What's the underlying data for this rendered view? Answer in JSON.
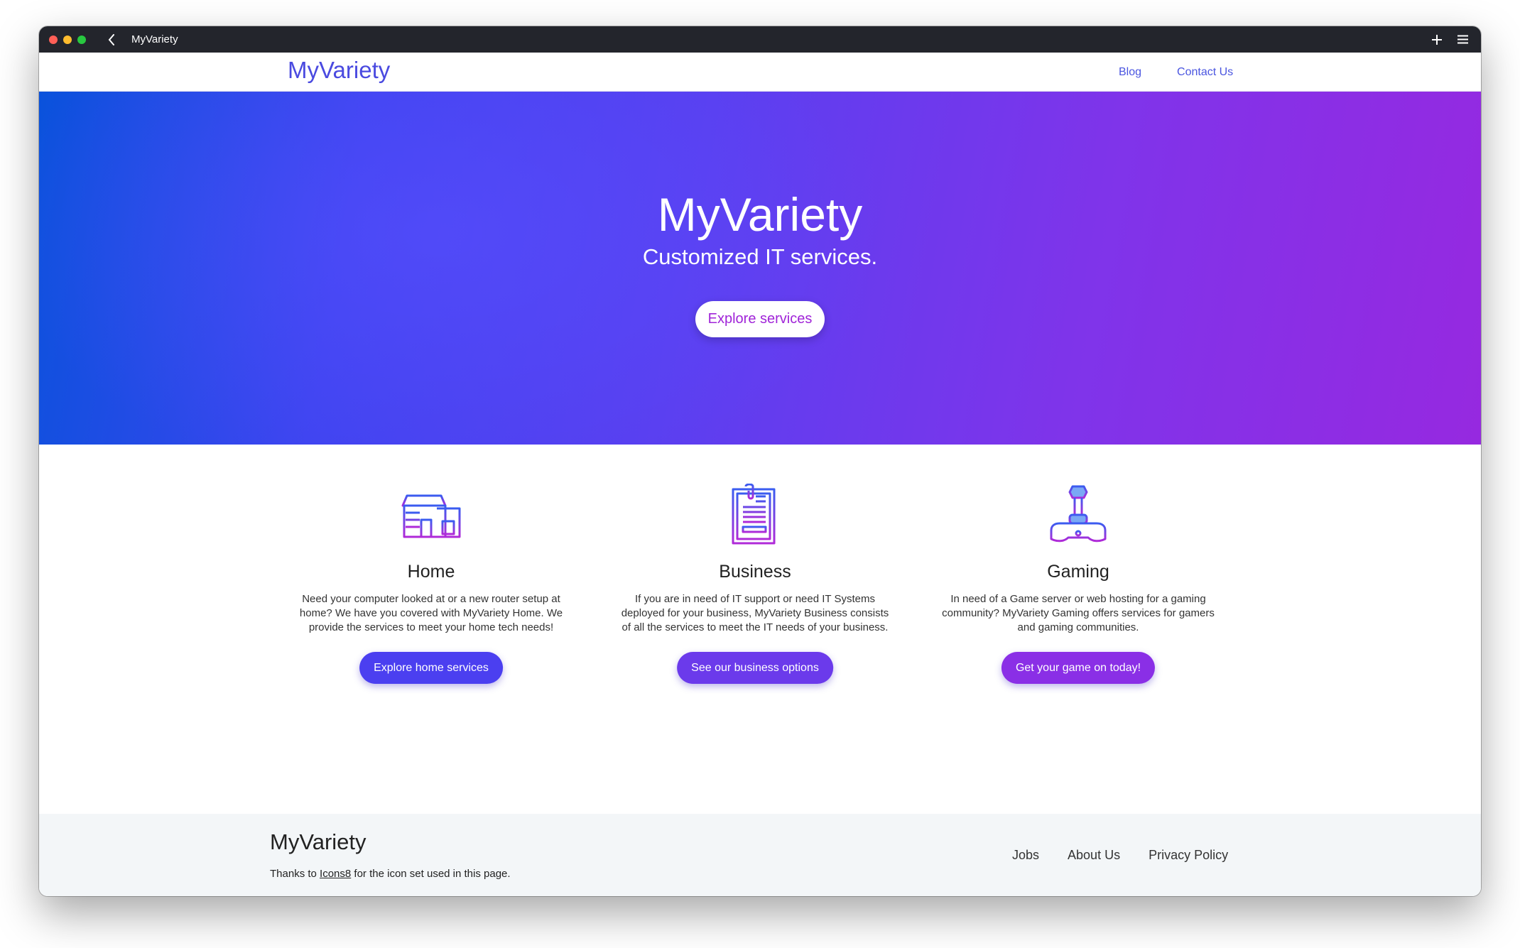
{
  "browser": {
    "tab_title": "MyVariety"
  },
  "nav": {
    "brand": "MyVariety",
    "links": [
      "Blog",
      "Contact Us"
    ]
  },
  "hero": {
    "title": "MyVariety",
    "subtitle": "Customized IT services.",
    "button": "Explore services"
  },
  "services": [
    {
      "icon": "house-icon",
      "title": "Home",
      "text": "Need your computer looked at or a new router setup at home? We have you covered with MyVariety Home. We provide the services to meet your home tech needs!",
      "button": "Explore home services",
      "button_color": "#4b3ff0"
    },
    {
      "icon": "clipboard-icon",
      "title": "Business",
      "text": "If you are in need of IT support or need IT Systems deployed for your business, MyVariety Business consists of all the services to meet the IT needs of your business.",
      "button": "See our business options",
      "button_color": "#6b3aeb"
    },
    {
      "icon": "joystick-icon",
      "title": "Gaming",
      "text": "In need of a Game server or web hosting for a gaming community? MyVariety Gaming offers services for gamers and gaming communities.",
      "button": "Get your game on today!",
      "button_color": "#8a2fe6"
    }
  ],
  "footer": {
    "brand": "MyVariety",
    "credit_prefix": "Thanks to ",
    "credit_link": "Icons8",
    "credit_suffix": " for the icon set used in this page.",
    "links": [
      "Jobs",
      "About Us",
      "Privacy Policy"
    ]
  },
  "colors": {
    "brand_blue": "#4a4ae0",
    "hero_start": "#0a52dc",
    "hero_end": "#9629e0",
    "hero_button_text": "#a024d8"
  }
}
